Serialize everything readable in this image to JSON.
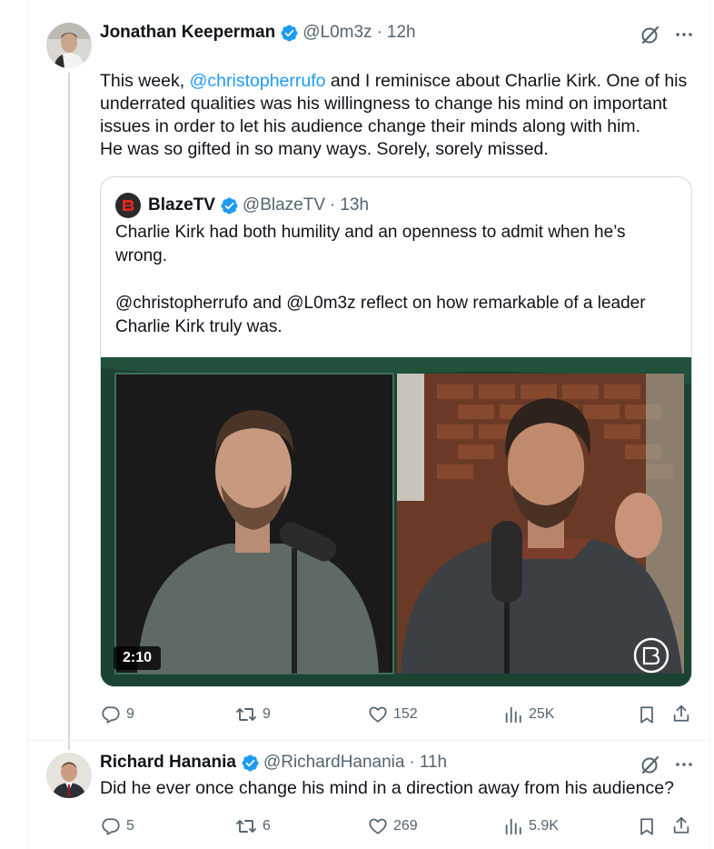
{
  "tweet1": {
    "author_name": "Jonathan Keeperman",
    "handle": "@L0m3z",
    "separator": "·",
    "time": "12h",
    "text_before_mention": "This week, ",
    "mention": "@christopherrufo",
    "text_after_mention": " and I reminisce about Charlie Kirk. One of his underrated qualities was his willingness to change his mind on important issues in order to let his audience change their minds along with him.",
    "text_paragraph2": "He was so gifted in so many ways. Sorely, sorely missed.",
    "stats": {
      "replies": "9",
      "reposts": "9",
      "likes": "152",
      "views": "25K"
    }
  },
  "quote": {
    "author_name": "BlazeTV",
    "handle": "@BlazeTV",
    "separator": "·",
    "time": "13h",
    "text": "Charlie Kirk had both humility and an openness to admit when he’s wrong.\n\n@christopherrufo and @L0m3z reflect on how remarkable of a leader Charlie Kirk truly was.",
    "video_duration": "2:10"
  },
  "tweet2": {
    "author_name": "Richard Hanania",
    "handle": "@RichardHanania",
    "separator": "·",
    "time": "11h",
    "text": "Did he ever once change his mind in a direction away from his audience?",
    "stats": {
      "replies": "5",
      "reposts": "6",
      "likes": "269",
      "views": "5.9K"
    }
  },
  "icons": {
    "reply": "reply-icon",
    "repost": "repost-icon",
    "like": "heart-icon",
    "views": "views-icon",
    "bookmark": "bookmark-icon",
    "share": "share-icon",
    "grok": "grok-icon",
    "more": "more-icon",
    "verified": "verified-badge-icon"
  },
  "colors": {
    "accent": "#1d9bf0",
    "text": "#0f1419",
    "muted": "#536471",
    "border": "#cfd9de"
  }
}
